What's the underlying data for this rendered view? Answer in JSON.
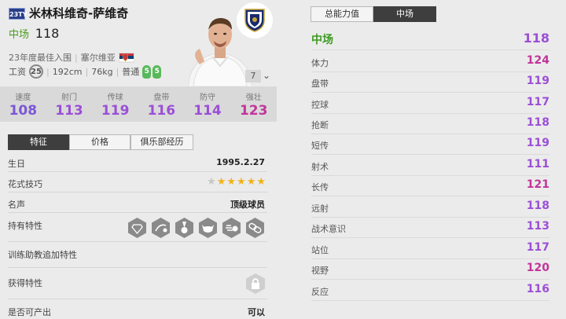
{
  "player": {
    "season": "23TY",
    "name": "米林科维奇-萨维奇",
    "position": "中场",
    "overall": "118",
    "program": "23年度最佳入围",
    "nationality": "塞尔维亚",
    "wage_label": "工资",
    "wage": "25",
    "height": "192cm",
    "weight": "76kg",
    "body": "普通",
    "weak_foot": "5",
    "strong_foot": "5",
    "level": "7"
  },
  "summary_stats": [
    {
      "label": "速度",
      "value": "108",
      "color": "#7b57d6"
    },
    {
      "label": "射门",
      "value": "113",
      "color": "#9b4fd6"
    },
    {
      "label": "传球",
      "value": "119",
      "color": "#9b4fd6"
    },
    {
      "label": "盘带",
      "value": "116",
      "color": "#9b4fd6"
    },
    {
      "label": "防守",
      "value": "114",
      "color": "#9b4fd6"
    },
    {
      "label": "强壮",
      "value": "123",
      "color": "#c2349a"
    }
  ],
  "left_tabs": [
    "特征",
    "价格",
    "俱乐部经历"
  ],
  "info": {
    "birthday_label": "生日",
    "birthday": "1995.2.27",
    "skill_label": "花式技巧",
    "skill_stars": 5,
    "reputation_label": "名声",
    "reputation": "顶级球员",
    "traits_label": "持有特性",
    "coach_label": "训练助教追加特性",
    "acquired_label": "获得特性",
    "tradable_label": "是否可产出",
    "tradable": "可以"
  },
  "right_tabs": [
    "总能力值",
    "中场"
  ],
  "attributes": [
    {
      "label": "中场",
      "value": "118",
      "color": "#9b4fd6",
      "main": true
    },
    {
      "label": "体力",
      "value": "124",
      "color": "#c2349a"
    },
    {
      "label": "盘带",
      "value": "119",
      "color": "#9b4fd6"
    },
    {
      "label": "控球",
      "value": "117",
      "color": "#9b4fd6"
    },
    {
      "label": "抢断",
      "value": "118",
      "color": "#9b4fd6"
    },
    {
      "label": "短传",
      "value": "119",
      "color": "#9b4fd6"
    },
    {
      "label": "射术",
      "value": "111",
      "color": "#9b4fd6"
    },
    {
      "label": "长传",
      "value": "121",
      "color": "#c2349a"
    },
    {
      "label": "远射",
      "value": "118",
      "color": "#9b4fd6"
    },
    {
      "label": "战术意识",
      "value": "113",
      "color": "#9b4fd6"
    },
    {
      "label": "站位",
      "value": "117",
      "color": "#9b4fd6"
    },
    {
      "label": "视野",
      "value": "120",
      "color": "#c2349a"
    },
    {
      "label": "反应",
      "value": "116",
      "color": "#9b4fd6"
    }
  ],
  "colors": {
    "position_green": "#4a9d1f",
    "tab_dark": "#3e3e3e",
    "star_gold": "#f1b21a"
  }
}
